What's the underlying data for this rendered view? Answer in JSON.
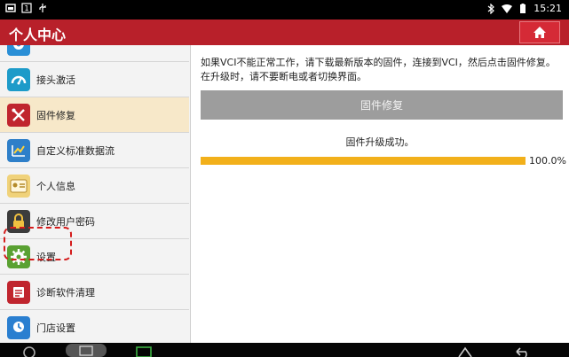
{
  "statusbar": {
    "time": "15:21"
  },
  "header": {
    "title": "个人中心"
  },
  "sidebar": {
    "items": [
      {
        "label": "",
        "icon": "gear-icon"
      },
      {
        "label": "接头激活",
        "icon": "gauge-icon"
      },
      {
        "label": "固件修复",
        "icon": "wrench-screwdriver-icon"
      },
      {
        "label": "自定义标准数据流",
        "icon": "chart-icon"
      },
      {
        "label": "个人信息",
        "icon": "id-card-icon"
      },
      {
        "label": "修改用户密码",
        "icon": "lock-icon"
      },
      {
        "label": "设置",
        "icon": "gear-icon"
      },
      {
        "label": "诊断软件清理",
        "icon": "cleanup-icon"
      },
      {
        "label": "门店设置",
        "icon": "store-icon"
      }
    ],
    "active_index": 2
  },
  "main": {
    "description": "如果VCI不能正常工作，请下载最新版本的固件，连接到VCI，然后点击固件修复。在升级时，请不要断电或者切换界面。",
    "button_label": "固件修复",
    "status": "固件升级成功。",
    "progress": {
      "value": 100,
      "label": "100.0%"
    }
  },
  "colors": {
    "header": "#b8202a",
    "active_item": "#f7e8c9",
    "progress": "#f2b01a",
    "button": "#9d9d9d",
    "highlight": "#d41b1b"
  }
}
